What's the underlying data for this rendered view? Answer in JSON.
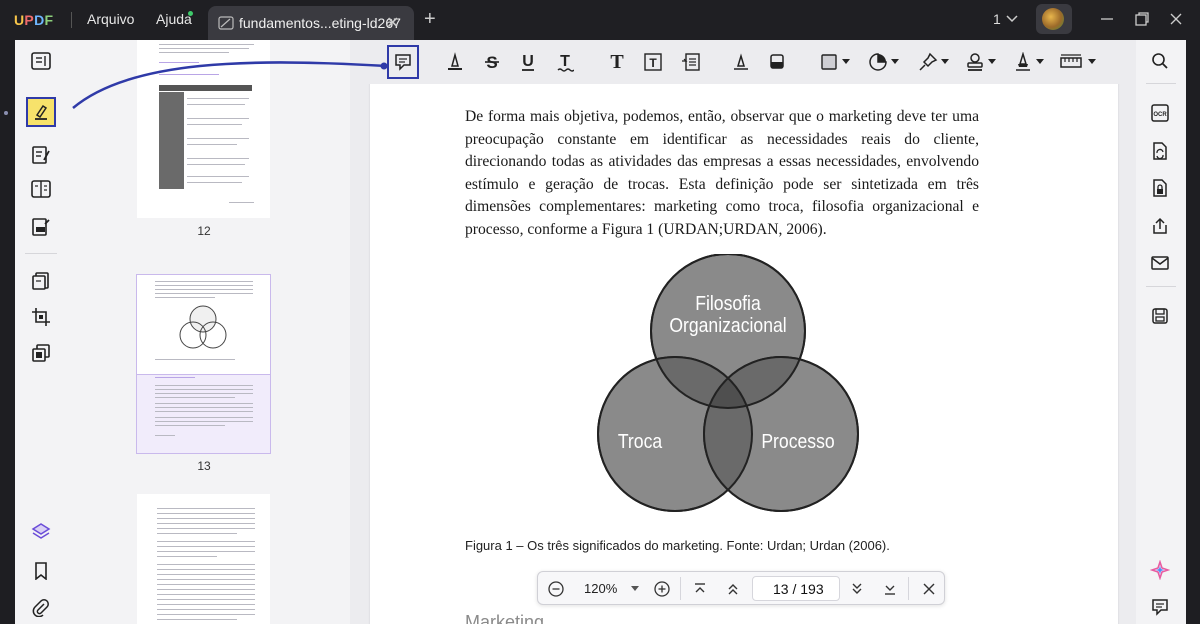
{
  "titlebar": {
    "logo": "UPDF",
    "menu_file": "Arquivo",
    "menu_help": "Ajuda",
    "tab_title": "fundamentos...eting-ld267",
    "tab_close": "✕",
    "add_tab": "+",
    "window_count": "1"
  },
  "thumbnails": {
    "pages": [
      "12",
      "13"
    ]
  },
  "document": {
    "paragraph": "De forma mais objetiva, podemos, então, observar que o marketing deve ter uma preocupação constante em identificar as necessidades reais do cliente, direcionando todas as atividades das empresas a essas necessidades, envolvendo estímulo e geração de trocas. Esta definição pode ser sintetizada em três dimensões complementares: marketing como troca, filosofia organizacional e processo, conforme a Figura 1 (URDAN;URDAN, 2006).",
    "venn": {
      "top_line1": "Filosofia",
      "top_line2": "Organizacional",
      "left": "Troca",
      "right": "Processo"
    },
    "caption": "Figura 1 – Os três significados do marketing. Fonte: Urdan; Urdan (2006).",
    "next_heading": "Marketing..."
  },
  "zoombar": {
    "zoom": "120%",
    "page": "13  /  193"
  },
  "colors": {
    "accent_blue": "#2f3aa8",
    "highlight_yellow": "#f7e26b",
    "venn_fill": "#8a8a8a",
    "venn_overlap": "#5c5c5c"
  }
}
